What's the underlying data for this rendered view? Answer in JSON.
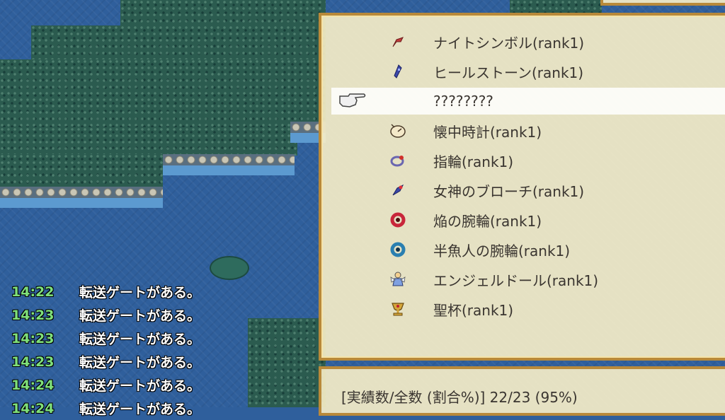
{
  "items": [
    {
      "label": "ナイトシンボル(rank1)",
      "icon": "knight-symbol-icon",
      "color": "#c23a3a"
    },
    {
      "label": "ヒールストーン(rank1)",
      "icon": "heal-stone-icon",
      "color": "#3b48a8"
    },
    {
      "label": "????????",
      "icon": "pointing-hand-cursor-icon",
      "selected": true
    },
    {
      "label": "懐中時計(rank1)",
      "icon": "pocket-watch-icon",
      "color": "#d8c49a"
    },
    {
      "label": "指輪(rank1)",
      "icon": "ring-icon",
      "color": "#6a66b0"
    },
    {
      "label": "女神のブローチ(rank1)",
      "icon": "goddess-brooch-icon",
      "color": "#3b48a8"
    },
    {
      "label": "焔の腕輪(rank1)",
      "icon": "flame-bracelet-icon",
      "color": "#c8263a"
    },
    {
      "label": "半魚人の腕輪(rank1)",
      "icon": "merman-bracelet-icon",
      "color": "#2a7fb0"
    },
    {
      "label": "エンジェルドール(rank1)",
      "icon": "angel-doll-icon",
      "color": "#7fa0e0"
    },
    {
      "label": "聖杯(rank1)",
      "icon": "holy-grail-icon",
      "color": "#d4a53a"
    }
  ],
  "status": {
    "text": "[実績数/全数 (割合%)] 22/23 (95%)"
  },
  "log": [
    {
      "time": "14:22",
      "message": "転送ゲートがある。"
    },
    {
      "time": "14:23",
      "message": "転送ゲートがある。"
    },
    {
      "time": "14:23",
      "message": "転送ゲートがある。"
    },
    {
      "time": "14:23",
      "message": "転送ゲートがある。"
    },
    {
      "time": "14:24",
      "message": "転送ゲートがある。"
    },
    {
      "time": "14:24",
      "message": "転送ゲートがある。"
    }
  ],
  "colors": {
    "log_time": "#7fe07a",
    "window_border": "#b8893a",
    "water": "#2f5f9c",
    "grass": "#2b5b4f"
  }
}
